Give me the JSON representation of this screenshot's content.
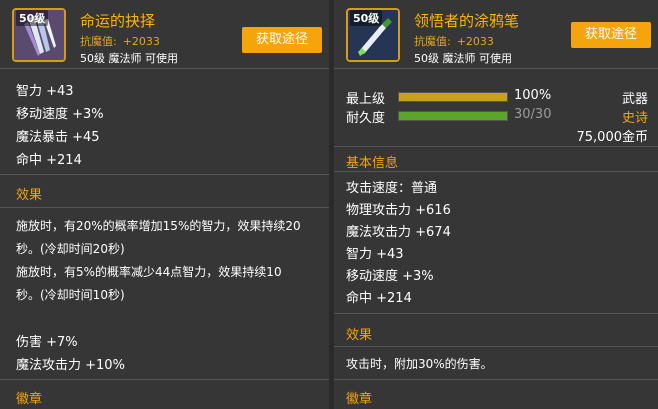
{
  "left": {
    "icon_level": "50级",
    "name": "命运的抉择",
    "resist_label": "抗魔值:",
    "resist_value": "+2033",
    "level_class": "50级 魔法师 可使用",
    "get_button": "获取途径",
    "stats": [
      "智力 +43",
      "移动速度 +3%",
      "魔法暴击 +45",
      "命中 +214"
    ],
    "effect_title": "效果",
    "effect_lines": [
      "施放时，有20%的概率增加15%的智力，效果持续20",
      "秒。(冷却时间20秒)",
      "施放时，有5%的概率减少44点智力，效果持续10",
      "秒。(冷却时间10秒)"
    ],
    "extra_stats": [
      "伤害 +7%",
      "魔法攻击力 +10%"
    ],
    "emblem_title": "徽章"
  },
  "right": {
    "icon_level": "50级",
    "name": "领悟者的涂鸦笔",
    "resist_label": "抗魔值:",
    "resist_value": "+2033",
    "level_class": "50级 魔法师 可使用",
    "get_button": "获取途径",
    "bars": [
      {
        "label": "最上级",
        "value": "100%",
        "fill": 1.0,
        "color": "#c8a21a",
        "value_color": "#ffffff",
        "tag": "武器",
        "tag_color": "#ffffff"
      },
      {
        "label": "耐久度",
        "value": "30/30",
        "fill": 1.0,
        "color": "#5aa52a",
        "value_color": "#9a9a9a",
        "tag": "史诗",
        "tag_color": "#f5a40c"
      }
    ],
    "price": "75,000金币",
    "basic_title": "基本信息",
    "stats": [
      "攻击速度：普通",
      "物理攻击力 +616",
      "魔法攻击力 +674",
      "智力 +43",
      "移动速度 +3%",
      "命中 +214"
    ],
    "effect_title": "效果",
    "effect_line": "攻击时，附加30%的伤害。",
    "emblem_title": "徽章"
  }
}
